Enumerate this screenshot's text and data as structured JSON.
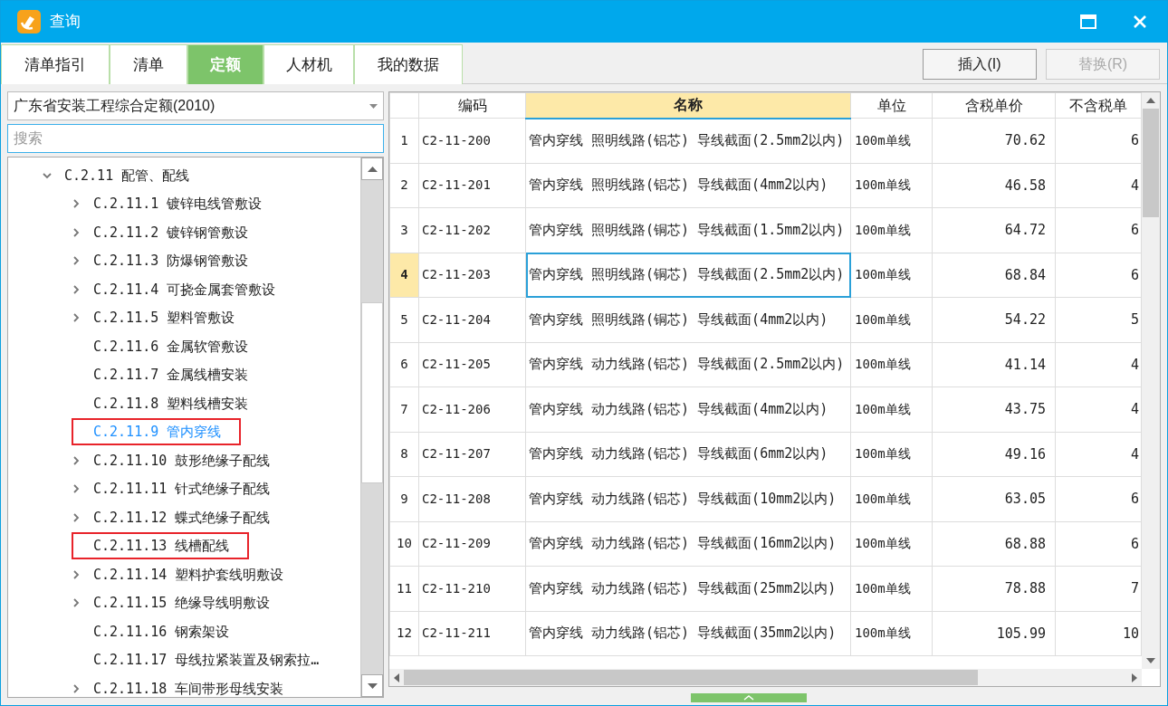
{
  "window": {
    "title": "查询"
  },
  "tabs": [
    {
      "label": "清单指引",
      "selected": false
    },
    {
      "label": "清单",
      "selected": false
    },
    {
      "label": "定额",
      "selected": true
    },
    {
      "label": "人材机",
      "selected": false
    },
    {
      "label": "我的数据",
      "selected": false
    }
  ],
  "buttons": [
    {
      "label": "插入(I)",
      "disabled": false
    },
    {
      "label": "替换(R)",
      "disabled": true
    }
  ],
  "library_select": {
    "value": "广东省安装工程综合定额(2010)"
  },
  "search": {
    "placeholder": "搜索"
  },
  "tree": [
    {
      "label": "C.2.11 配管、配线",
      "expanded": true,
      "children": [
        {
          "label": "C.2.11.1 镀锌电线管敷设",
          "expandable": true,
          "selected": false,
          "boxed": false
        },
        {
          "label": "C.2.11.2 镀锌钢管敷设",
          "expandable": true,
          "selected": false,
          "boxed": false
        },
        {
          "label": "C.2.11.3 防爆钢管敷设",
          "expandable": true,
          "selected": false,
          "boxed": false
        },
        {
          "label": "C.2.11.4 可挠金属套管敷设",
          "expandable": true,
          "selected": false,
          "boxed": false
        },
        {
          "label": "C.2.11.5 塑料管敷设",
          "expandable": true,
          "selected": false,
          "boxed": false
        },
        {
          "label": "C.2.11.6 金属软管敷设",
          "expandable": false,
          "selected": false,
          "boxed": false
        },
        {
          "label": "C.2.11.7 金属线槽安装",
          "expandable": false,
          "selected": false,
          "boxed": false
        },
        {
          "label": "C.2.11.8 塑料线槽安装",
          "expandable": false,
          "selected": false,
          "boxed": false
        },
        {
          "label": "C.2.11.9 管内穿线",
          "expandable": false,
          "selected": true,
          "boxed": true
        },
        {
          "label": "C.2.11.10 鼓形绝缘子配线",
          "expandable": true,
          "selected": false,
          "boxed": false
        },
        {
          "label": "C.2.11.11 针式绝缘子配线",
          "expandable": true,
          "selected": false,
          "boxed": false
        },
        {
          "label": "C.2.11.12 蝶式绝缘子配线",
          "expandable": true,
          "selected": false,
          "boxed": false
        },
        {
          "label": "C.2.11.13 线槽配线",
          "expandable": false,
          "selected": false,
          "boxed": true
        },
        {
          "label": "C.2.11.14 塑料护套线明敷设",
          "expandable": true,
          "selected": false,
          "boxed": false
        },
        {
          "label": "C.2.11.15 绝缘导线明敷设",
          "expandable": true,
          "selected": false,
          "boxed": false
        },
        {
          "label": "C.2.11.16 钢索架设",
          "expandable": false,
          "selected": false,
          "boxed": false
        },
        {
          "label": "C.2.11.17 母线拉紧装置及钢索拉…",
          "expandable": false,
          "selected": false,
          "boxed": false
        },
        {
          "label": "C.2.11.18 车间带形母线安装",
          "expandable": true,
          "selected": false,
          "boxed": false
        }
      ]
    }
  ],
  "table": {
    "columns": [
      {
        "label": "编码",
        "selected": false
      },
      {
        "label": "名称",
        "selected": true
      },
      {
        "label": "单位",
        "selected": false
      },
      {
        "label": "含税单价",
        "selected": false
      },
      {
        "label": "不含税单",
        "selected": false
      }
    ],
    "rows": [
      {
        "index": "1",
        "code": "C2-11-200",
        "name": "管内穿线 照明线路(铝芯) 导线截面(2.5mm2以内)",
        "unit": "100m单线",
        "price_tax": "70.62",
        "price_notax": "6",
        "selected": false
      },
      {
        "index": "2",
        "code": "C2-11-201",
        "name": "管内穿线 照明线路(铝芯) 导线截面(4mm2以内)",
        "unit": "100m单线",
        "price_tax": "46.58",
        "price_notax": "4",
        "selected": false
      },
      {
        "index": "3",
        "code": "C2-11-202",
        "name": "管内穿线 照明线路(铜芯) 导线截面(1.5mm2以内)",
        "unit": "100m单线",
        "price_tax": "64.72",
        "price_notax": "6",
        "selected": false
      },
      {
        "index": "4",
        "code": "C2-11-203",
        "name": "管内穿线 照明线路(铜芯) 导线截面(2.5mm2以内)",
        "unit": "100m单线",
        "price_tax": "68.84",
        "price_notax": "6",
        "selected": true
      },
      {
        "index": "5",
        "code": "C2-11-204",
        "name": "管内穿线 照明线路(铜芯) 导线截面(4mm2以内)",
        "unit": "100m单线",
        "price_tax": "54.22",
        "price_notax": "5",
        "selected": false
      },
      {
        "index": "6",
        "code": "C2-11-205",
        "name": "管内穿线 动力线路(铝芯) 导线截面(2.5mm2以内)",
        "unit": "100m单线",
        "price_tax": "41.14",
        "price_notax": "4",
        "selected": false
      },
      {
        "index": "7",
        "code": "C2-11-206",
        "name": "管内穿线 动力线路(铝芯) 导线截面(4mm2以内)",
        "unit": "100m单线",
        "price_tax": "43.75",
        "price_notax": "4",
        "selected": false
      },
      {
        "index": "8",
        "code": "C2-11-207",
        "name": "管内穿线 动力线路(铝芯) 导线截面(6mm2以内)",
        "unit": "100m单线",
        "price_tax": "49.16",
        "price_notax": "4",
        "selected": false
      },
      {
        "index": "9",
        "code": "C2-11-208",
        "name": "管内穿线 动力线路(铝芯) 导线截面(10mm2以内)",
        "unit": "100m单线",
        "price_tax": "63.05",
        "price_notax": "6",
        "selected": false
      },
      {
        "index": "10",
        "code": "C2-11-209",
        "name": "管内穿线 动力线路(铝芯) 导线截面(16mm2以内)",
        "unit": "100m单线",
        "price_tax": "68.88",
        "price_notax": "6",
        "selected": false
      },
      {
        "index": "11",
        "code": "C2-11-210",
        "name": "管内穿线 动力线路(铝芯) 导线截面(25mm2以内)",
        "unit": "100m单线",
        "price_tax": "78.88",
        "price_notax": "7",
        "selected": false
      },
      {
        "index": "12",
        "code": "C2-11-211",
        "name": "管内穿线 动力线路(铝芯) 导线截面(35mm2以内)",
        "unit": "100m单线",
        "price_tax": "105.99",
        "price_notax": "10",
        "selected": false
      }
    ]
  }
}
